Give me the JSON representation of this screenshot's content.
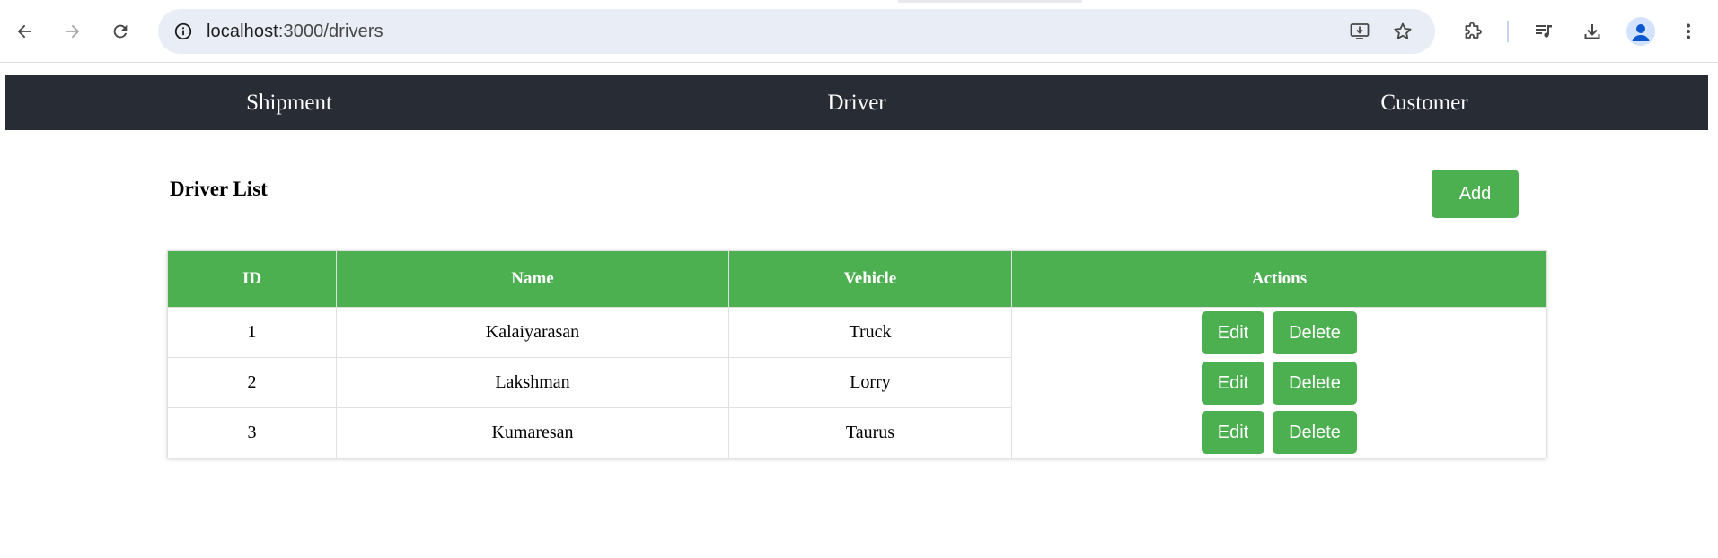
{
  "browser": {
    "url_host": "localhost",
    "url_path": ":3000/drivers"
  },
  "navbar": {
    "links": [
      {
        "label": "Shipment"
      },
      {
        "label": "Driver"
      },
      {
        "label": "Customer"
      }
    ],
    "background": "#282c34"
  },
  "page": {
    "title": "Driver List",
    "add_label": "Add"
  },
  "table": {
    "headers": [
      "ID",
      "Name",
      "Vehicle",
      "Actions"
    ],
    "rows": [
      {
        "id": "1",
        "name": "Kalaiyarasan",
        "vehicle": "Truck"
      },
      {
        "id": "2",
        "name": "Lakshman",
        "vehicle": "Lorry"
      },
      {
        "id": "3",
        "name": "Kumaresan",
        "vehicle": "Taurus"
      }
    ],
    "edit_label": "Edit",
    "delete_label": "Delete"
  },
  "colors": {
    "accent": "#4caf50",
    "header_text": "#ffffff"
  }
}
